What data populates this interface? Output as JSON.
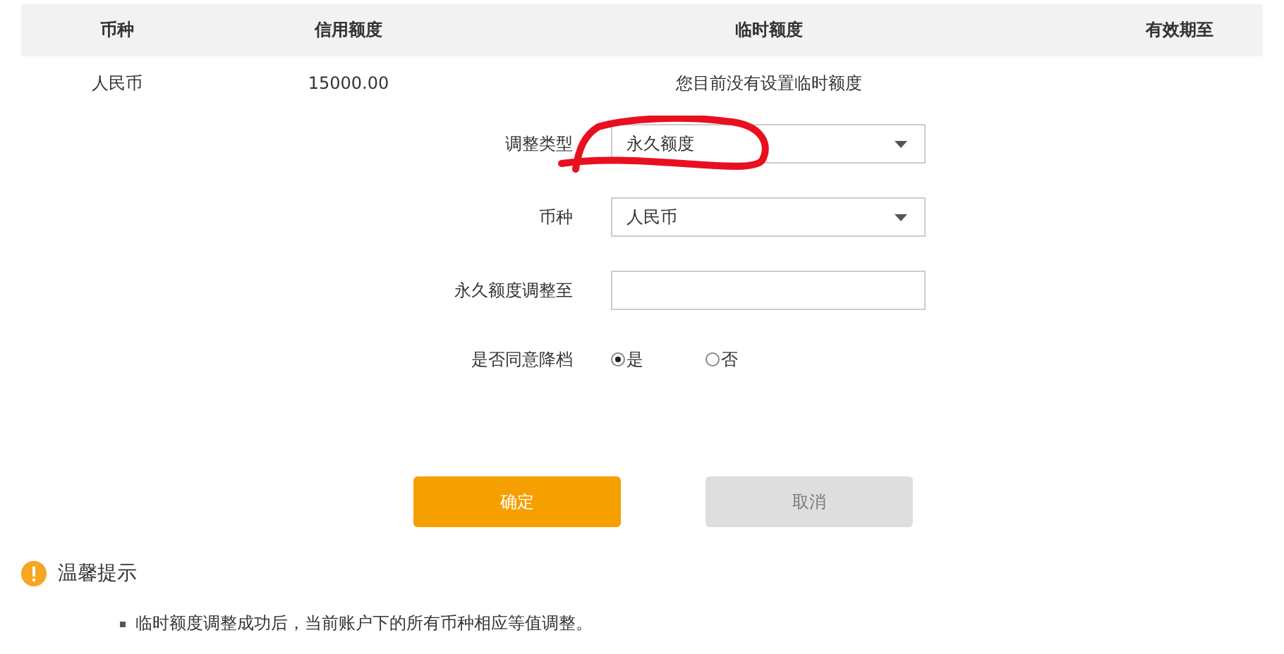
{
  "table": {
    "columns": [
      "币种",
      "信用额度",
      "临时额度",
      "有效期至"
    ],
    "rows": [
      [
        "人民币",
        "15000.00",
        "您目前没有设置临时额度"
      ]
    ]
  },
  "form": {
    "fields": [
      {
        "kind": "select",
        "label": "调整类型",
        "value": "永久额度"
      },
      {
        "kind": "select",
        "label": "币种",
        "value": "人民币"
      },
      {
        "kind": "input",
        "label": "永久额度调整至"
      },
      {
        "kind": "radio",
        "label": "是否同意降档",
        "options": [
          {
            "label": "是",
            "selected": true
          },
          {
            "label": "否",
            "selected": false
          }
        ]
      }
    ]
  },
  "buttons": [
    {
      "label": "确定",
      "disabled": false
    },
    {
      "label": "取消",
      "disabled": true
    }
  ],
  "tips": {
    "title": "温馨提示",
    "items": [
      "临时额度调整成功后，当前账户下的所有币种相应等值调整。"
    ]
  }
}
